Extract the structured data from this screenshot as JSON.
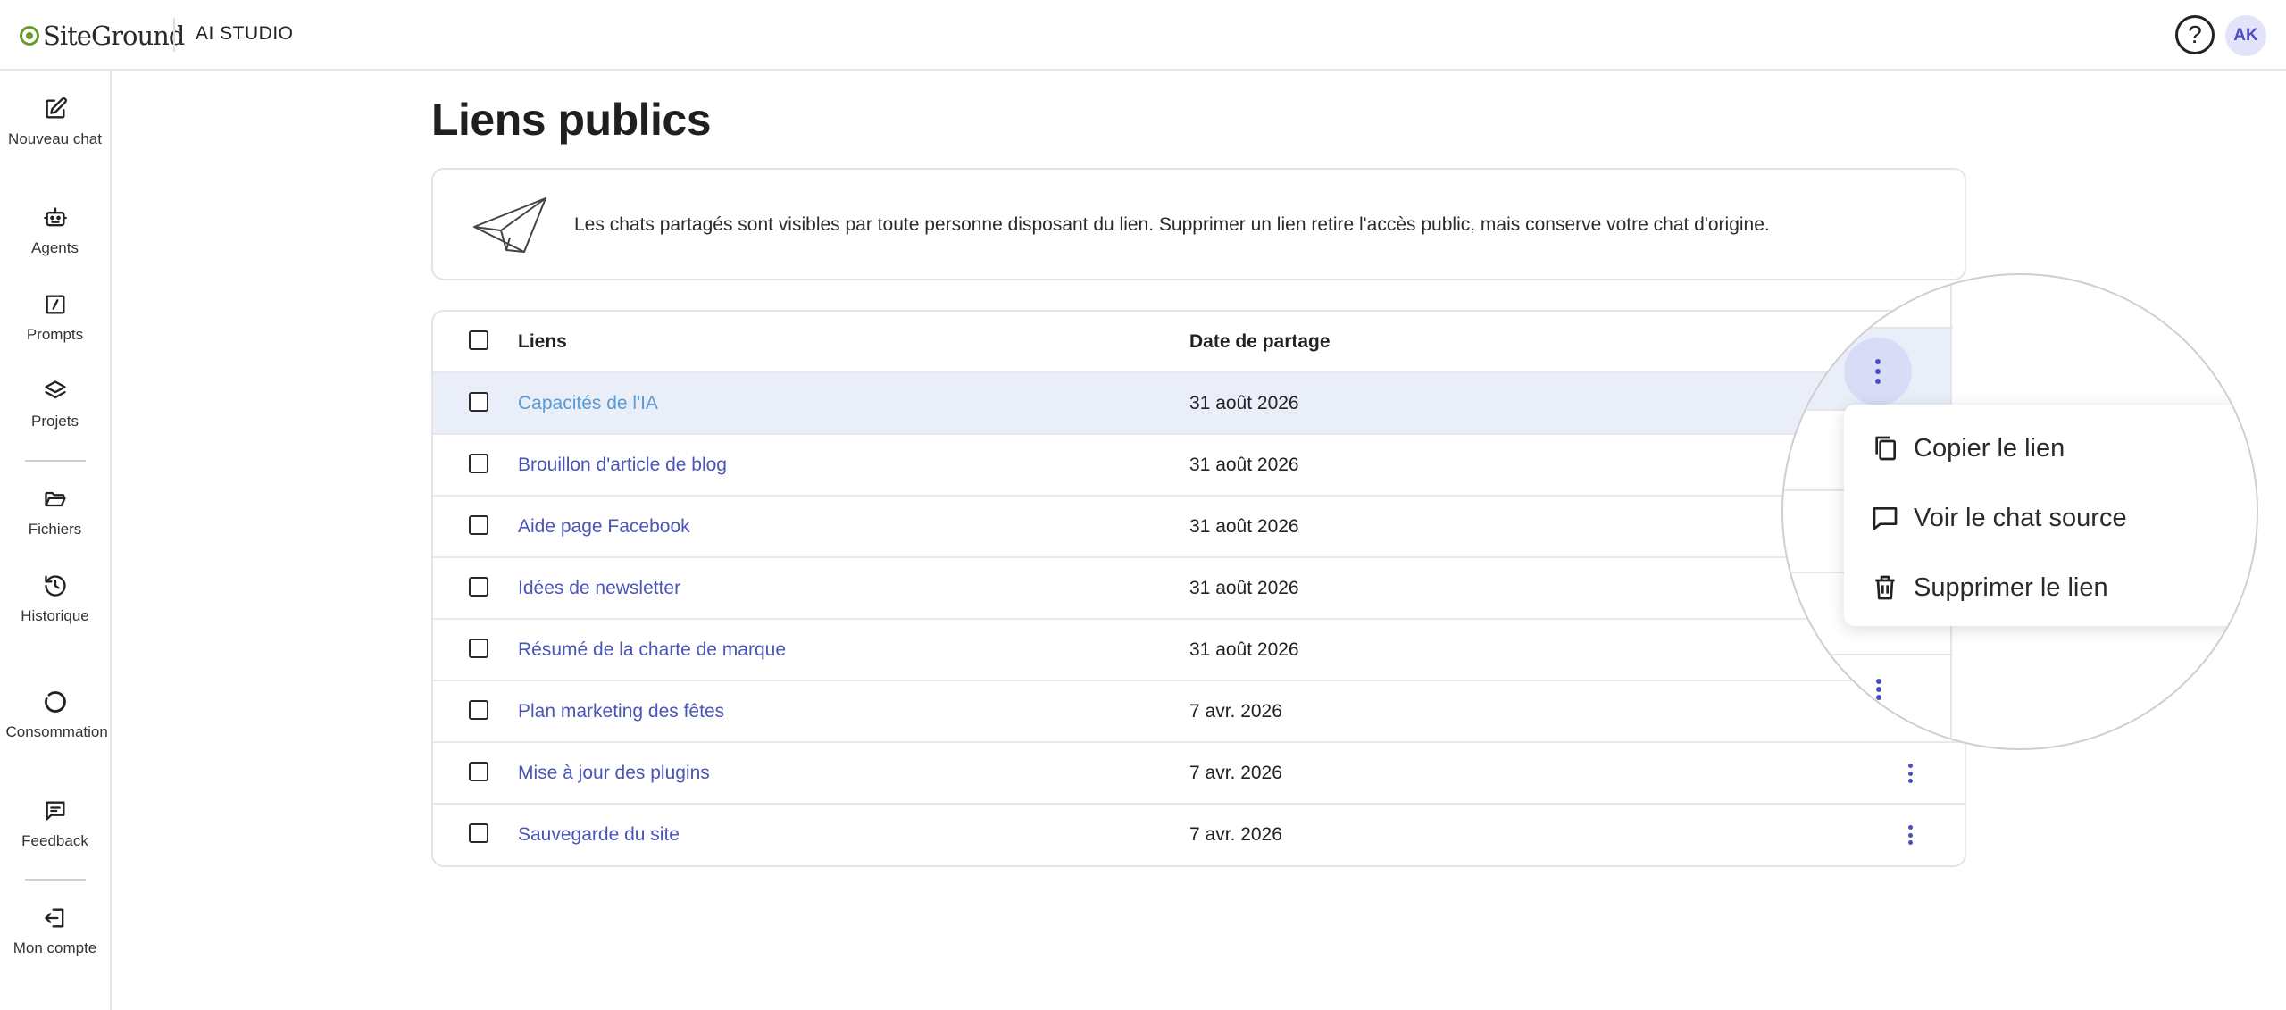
{
  "header": {
    "logo_text": "SiteGround",
    "app_name": "AI STUDIO",
    "help_label": "?",
    "avatar_initials": "AK"
  },
  "sidebar": {
    "items": [
      {
        "label": "Nouveau chat",
        "icon": "edit-icon"
      },
      {
        "label": "Agents",
        "icon": "robot-icon"
      },
      {
        "label": "Prompts",
        "icon": "prompt-icon"
      },
      {
        "label": "Projets",
        "icon": "layers-icon"
      },
      {
        "label": "Fichiers",
        "icon": "folder-icon"
      },
      {
        "label": "Historique",
        "icon": "history-icon"
      },
      {
        "label": "Consommation",
        "icon": "usage-icon"
      },
      {
        "label": "Feedback",
        "icon": "feedback-icon"
      },
      {
        "label": "Mon compte",
        "icon": "logout-icon"
      }
    ]
  },
  "page": {
    "title": "Liens publics",
    "info_text": "Les chats partagés sont visibles par toute personne disposant du lien. Supprimer un lien retire l'accès public, mais conserve votre chat d'origine."
  },
  "table": {
    "columns": [
      "Liens",
      "Date de partage"
    ],
    "rows": [
      {
        "name": "Capacités de l'IA",
        "date": "31 août 2026"
      },
      {
        "name": "Brouillon d'article de blog",
        "date": "31 août 2026"
      },
      {
        "name": "Aide page Facebook",
        "date": "31 août 2026"
      },
      {
        "name": "Idées de newsletter",
        "date": "31 août 2026"
      },
      {
        "name": "Résumé de la charte de marque",
        "date": "31 août 2026"
      },
      {
        "name": "Plan marketing des fêtes",
        "date": "7 avr. 2026"
      },
      {
        "name": "Mise à jour des plugins",
        "date": "7 avr. 2026"
      },
      {
        "name": "Sauvegarde du site",
        "date": "7 avr. 2026"
      }
    ]
  },
  "context_menu": {
    "items": [
      {
        "label": "Copier le lien",
        "icon": "copy-icon"
      },
      {
        "label": "Voir le chat source",
        "icon": "chat-bubble-icon"
      },
      {
        "label": "Supprimer le lien",
        "icon": "trash-icon"
      }
    ]
  },
  "colors": {
    "link": "#4a55b8",
    "link_highlighted": "#5b9bd5",
    "row_highlight": "#e9eef8",
    "accent": "#4a4fbf",
    "brand_green": "#6a9b2c"
  }
}
